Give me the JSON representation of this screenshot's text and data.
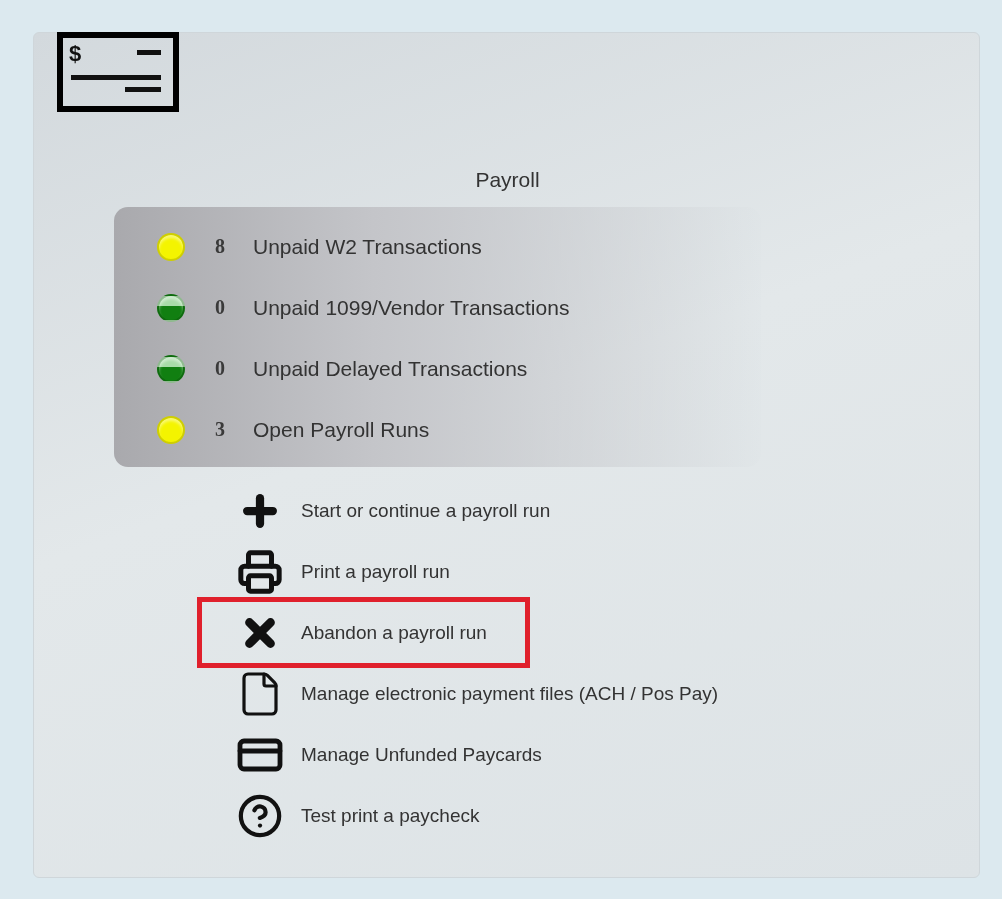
{
  "panel": {
    "icon_symbol": "$",
    "title": "Payroll",
    "indicators": [
      {
        "color": "#f4f400",
        "count": "8",
        "label": "Unpaid W2 Transactions"
      },
      {
        "color": "#117f11",
        "count": "0",
        "label": "Unpaid 1099/Vendor Transactions"
      },
      {
        "color": "#117f11",
        "count": "0",
        "label": "Unpaid Delayed Transactions"
      },
      {
        "color": "#f4f400",
        "count": "3",
        "label": "Open Payroll Runs"
      }
    ],
    "actions": [
      {
        "kind": "add",
        "label": "Start or continue a payroll run",
        "highlighted": false
      },
      {
        "kind": "print",
        "label": "Print a payroll run",
        "highlighted": false
      },
      {
        "kind": "abandon",
        "label": "Abandon a payroll run",
        "highlighted": true
      },
      {
        "kind": "file",
        "label": "Manage electronic payment files (ACH / Pos Pay)",
        "highlighted": false
      },
      {
        "kind": "paycard",
        "label": "Manage Unfunded Paycards",
        "highlighted": false
      },
      {
        "kind": "help",
        "label": "Test print a paycheck",
        "highlighted": false
      }
    ]
  }
}
